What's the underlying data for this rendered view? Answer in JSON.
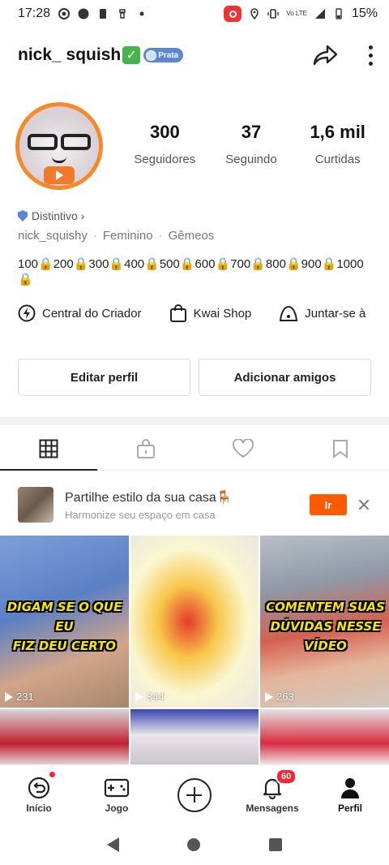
{
  "status_bar": {
    "time": "17:28",
    "battery": "15%",
    "network_label": "Vo LTE"
  },
  "profile": {
    "username": "nick_ squish",
    "verified_mark": "✓",
    "badge_label": "Prata",
    "stats": [
      {
        "value": "300",
        "label": "Seguidores"
      },
      {
        "value": "37",
        "label": "Seguindo"
      },
      {
        "value": "1,6 mil",
        "label": "Curtidas"
      }
    ],
    "distintivo_label": "Distintivo ›",
    "meta": [
      "nick_squishy",
      "Feminino",
      "Gêmeos"
    ],
    "bio": "100🔒200🔒300🔒400🔒500🔒600🔒700🔒800🔒900🔒1000🔒"
  },
  "creator_row": [
    {
      "label": "Central do Criador",
      "icon": "lightning-icon"
    },
    {
      "label": "Kwai Shop",
      "icon": "shopping-bag-icon"
    },
    {
      "label": "Juntar-se à",
      "icon": "tent-icon"
    }
  ],
  "buttons": {
    "edit_profile": "Editar perfil",
    "add_friends": "Adicionar amigos"
  },
  "tabs": [
    {
      "name": "grid",
      "icon": "grid-icon",
      "active": true
    },
    {
      "name": "private",
      "icon": "lock-bag-icon",
      "active": false
    },
    {
      "name": "likes",
      "icon": "heart-icon",
      "active": false
    },
    {
      "name": "saved",
      "icon": "bookmark-icon",
      "active": false
    }
  ],
  "promo": {
    "title": "Partilhe estilo da sua casa🪑",
    "subtitle": "Harmonize seu espaço em casa",
    "button": "Ir"
  },
  "videos": [
    {
      "caption_lines": [
        "DIGAM SE O QUE EU",
        "FIZ DEU CERTO"
      ],
      "views": "231"
    },
    {
      "caption_lines": [],
      "views": "344"
    },
    {
      "caption_lines": [
        "COMENTEM SUAS",
        "DÚVIDAS NESSE",
        "VÍDEO"
      ],
      "views": "263"
    },
    {
      "caption_lines": [],
      "views": ""
    },
    {
      "caption_lines": [],
      "views": ""
    },
    {
      "caption_lines": [],
      "views": ""
    }
  ],
  "bottom_nav": [
    {
      "label": "Início",
      "icon": "home-back-icon"
    },
    {
      "label": "Jogo",
      "icon": "gamepad-icon"
    },
    {
      "label": "",
      "icon": "plus-icon"
    },
    {
      "label": "Mensagens",
      "icon": "bell-icon",
      "badge": "60"
    },
    {
      "label": "Perfil",
      "icon": "person-icon",
      "active": true
    }
  ],
  "colors": {
    "accent": "#ff5a00",
    "verified": "#43b54a",
    "badge_blue": "#5b86d6",
    "notification": "#ff2233"
  }
}
